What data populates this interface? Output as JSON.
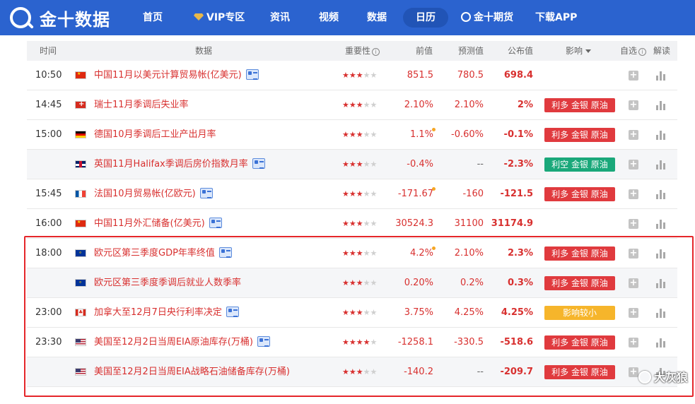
{
  "nav": {
    "logo_text": "金十数据",
    "items": [
      {
        "label": "首页",
        "active": false
      },
      {
        "label": "VIP专区",
        "active": false
      },
      {
        "label": "资讯",
        "active": false
      },
      {
        "label": "视频",
        "active": false
      },
      {
        "label": "数据",
        "active": false
      },
      {
        "label": "日历",
        "active": true
      },
      {
        "label": "金十期货",
        "active": false
      },
      {
        "label": "下载APP",
        "active": false
      }
    ]
  },
  "table": {
    "headers": {
      "time": "时间",
      "data": "数据",
      "importance": "重要性",
      "previous": "前值",
      "forecast": "预测值",
      "actual": "公布值",
      "impact": "影响",
      "watch": "自选",
      "analysis": "解读"
    },
    "rows": [
      {
        "time": "10:50",
        "flag": "cn",
        "name": "中国11月以美元计算贸易帐(亿美元)",
        "doc": true,
        "stars": 3,
        "previous": "851.5",
        "forecast": "780.5",
        "actual": "698.4",
        "impact": "",
        "prev_revised": false
      },
      {
        "time": "14:45",
        "flag": "ch",
        "name": "瑞士11月季调后失业率",
        "doc": false,
        "stars": 3,
        "previous": "2.10%",
        "forecast": "2.10%",
        "actual": "2%",
        "impact": "利多 金银 原油",
        "impact_color": "red",
        "prev_revised": false
      },
      {
        "time": "15:00",
        "flag": "de",
        "name": "德国10月季调后工业产出月率",
        "doc": false,
        "stars": 3,
        "previous": "1.1%",
        "forecast": "-0.60%",
        "actual": "-0.1%",
        "impact": "利多 金银 原油",
        "impact_color": "red",
        "prev_revised": true
      },
      {
        "time": "",
        "flag": "uk",
        "name": "英国11月Halifax季调后房价指数月率",
        "doc": true,
        "stars": 3,
        "previous": "-0.4%",
        "forecast": "--",
        "actual": "-2.3%",
        "impact": "利空 金银 原油",
        "impact_color": "green",
        "prev_revised": false
      },
      {
        "time": "15:45",
        "flag": "fr",
        "name": "法国10月贸易帐(亿欧元)",
        "doc": true,
        "stars": 3,
        "previous": "-171.67",
        "forecast": "-160",
        "actual": "-121.5",
        "impact": "利多 金银 原油",
        "impact_color": "red",
        "prev_revised": true
      },
      {
        "time": "16:00",
        "flag": "cn",
        "name": "中国11月外汇储备(亿美元)",
        "doc": true,
        "stars": 3,
        "previous": "30524.3",
        "forecast": "31100",
        "actual": "31174.9",
        "impact": "",
        "prev_revised": false
      },
      {
        "time": "18:00",
        "flag": "eu",
        "name": "欧元区第三季度GDP年率终值",
        "doc": true,
        "stars": 3,
        "previous": "4.2%",
        "forecast": "2.10%",
        "actual": "2.3%",
        "impact": "利多 金银 原油",
        "impact_color": "red",
        "prev_revised": true
      },
      {
        "time": "",
        "flag": "eu",
        "name": "欧元区第三季度季调后就业人数季率",
        "doc": false,
        "stars": 3,
        "previous": "0.20%",
        "forecast": "0.2%",
        "actual": "0.3%",
        "impact": "利多 金银 原油",
        "impact_color": "red",
        "prev_revised": false
      },
      {
        "time": "23:00",
        "flag": "ca",
        "name": "加拿大至12月7日央行利率决定",
        "doc": true,
        "stars": 3,
        "previous": "3.75%",
        "forecast": "4.25%",
        "actual": "4.25%",
        "impact": "影响较小",
        "impact_color": "yellow",
        "prev_revised": false
      },
      {
        "time": "23:30",
        "flag": "us",
        "name": "美国至12月2日当周EIA原油库存(万桶)",
        "doc": true,
        "stars": 4,
        "previous": "-1258.1",
        "forecast": "-330.5",
        "actual": "-518.6",
        "impact": "利多 金银 原油",
        "impact_color": "red",
        "prev_revised": false
      },
      {
        "time": "",
        "flag": "us",
        "name": "美国至12月2日当周EIA战略石油储备库存(万桶)",
        "doc": false,
        "stars": 3,
        "previous": "-140.2",
        "forecast": "--",
        "actual": "-209.7",
        "impact": "利多 金银 原油",
        "impact_color": "red",
        "prev_revised": false
      }
    ]
  },
  "watermark": {
    "text": "大灰狼"
  },
  "colors": {
    "nav": "#2b63cf",
    "red": "#d8302f",
    "badge_red": "#e03a3e",
    "badge_green": "#1aa87a",
    "badge_yellow": "#f6b52b",
    "highlight": "#e5262a"
  }
}
